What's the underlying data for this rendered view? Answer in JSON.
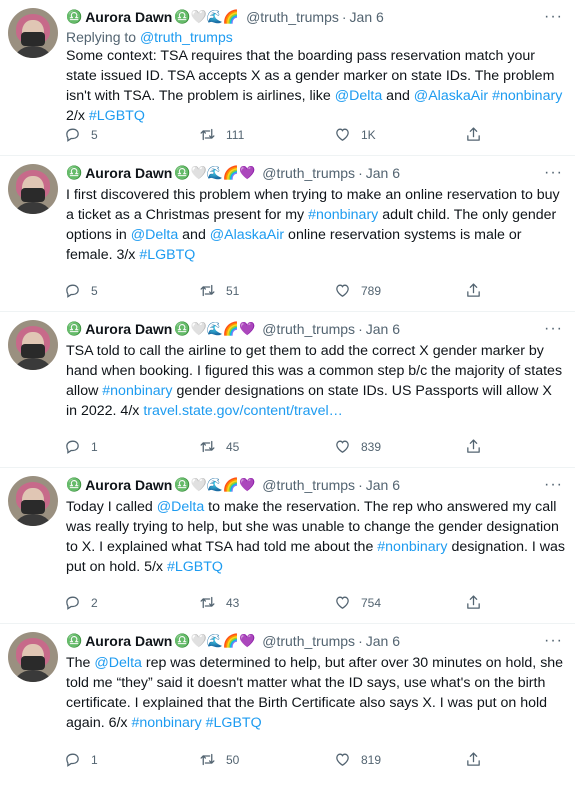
{
  "tweets": [
    {
      "name": "Aurora Dawn",
      "emoji_before": "♎",
      "emoji_after": "♎🤍🌊🌈",
      "handle": "@truth_trumps",
      "date": "Jan 6",
      "replying_prefix": "Replying to ",
      "replying_handle": "@truth_trumps",
      "text_parts": [
        {
          "t": "Some context: TSA requires that the boarding pass reservation match your state issued ID. TSA accepts X as a gender marker on state IDs. The problem isn't with TSA. The problem is airlines, like "
        },
        {
          "t": "@Delta",
          "link": true
        },
        {
          "t": " and "
        },
        {
          "t": "@AlaskaAir",
          "link": true
        },
        {
          "t": " "
        },
        {
          "t": "#nonbinary",
          "link": true
        },
        {
          "t": " 2/x "
        },
        {
          "t": "#LGBTQ",
          "link": true
        }
      ],
      "replies": "5",
      "retweets": "111",
      "likes": "1K"
    },
    {
      "name": "Aurora Dawn",
      "emoji_before": "♎",
      "emoji_after": "♎🤍🌊🌈💜",
      "handle": "@truth_trumps",
      "date": "Jan 6",
      "text_parts": [
        {
          "t": "I first discovered this problem when trying to make an online reservation to buy a ticket as a Christmas present for my "
        },
        {
          "t": "#nonbinary",
          "link": true
        },
        {
          "t": " adult child. The only gender options in "
        },
        {
          "t": "@Delta",
          "link": true
        },
        {
          "t": " and "
        },
        {
          "t": "@AlaskaAir",
          "link": true
        },
        {
          "t": " online reservation systems is male or female. 3/x "
        },
        {
          "t": "#LGBTQ",
          "link": true
        }
      ],
      "replies": "5",
      "retweets": "51",
      "likes": "789"
    },
    {
      "name": "Aurora Dawn",
      "emoji_before": "♎",
      "emoji_after": "♎🤍🌊🌈💜",
      "handle": "@truth_trumps",
      "date": "Jan 6",
      "text_parts": [
        {
          "t": "TSA told to call the airline to get them to add the correct X gender marker by hand when booking. I figured this was a common step b/c the majority of states allow "
        },
        {
          "t": "#nonbinary",
          "link": true
        },
        {
          "t": " gender designations on state IDs. US Passports will allow X in 2022. 4/x "
        },
        {
          "t": "travel.state.gov/content/travel…",
          "link": true
        }
      ],
      "replies": "1",
      "retweets": "45",
      "likes": "839"
    },
    {
      "name": "Aurora Dawn",
      "emoji_before": "♎",
      "emoji_after": "♎🤍🌊🌈💜",
      "handle": "@truth_trumps",
      "date": "Jan 6",
      "text_parts": [
        {
          "t": "Today I called "
        },
        {
          "t": "@Delta",
          "link": true
        },
        {
          "t": " to make the reservation. The rep who answered my call was really trying to help, but she was unable to change the gender designation to X. I explained what TSA had told me about the "
        },
        {
          "t": "#nonbinary",
          "link": true
        },
        {
          "t": " designation. I was put on hold. 5/x "
        },
        {
          "t": "#LGBTQ",
          "link": true
        }
      ],
      "replies": "2",
      "retweets": "43",
      "likes": "754"
    },
    {
      "name": "Aurora Dawn",
      "emoji_before": "♎",
      "emoji_after": "♎🤍🌊🌈💜",
      "handle": "@truth_trumps",
      "date": "Jan 6",
      "text_parts": [
        {
          "t": "The "
        },
        {
          "t": "@Delta",
          "link": true
        },
        {
          "t": " rep was determined to help, but after over 30 minutes on hold, she told me “they” said it doesn't matter what the ID says, use what's on the birth certificate. I explained that the Birth Certificate also says X. I was put on hold again. 6/x "
        },
        {
          "t": "#nonbinary",
          "link": true
        },
        {
          "t": " "
        },
        {
          "t": "#LGBTQ",
          "link": true
        }
      ],
      "replies": "1",
      "retweets": "50",
      "likes": "819"
    }
  ],
  "labels": {
    "dot": "·",
    "more": "···"
  },
  "icons": [
    "reply-icon",
    "retweet-icon",
    "like-icon",
    "share-icon"
  ]
}
